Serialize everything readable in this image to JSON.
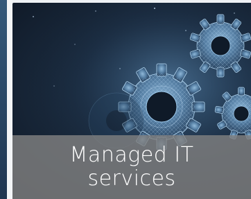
{
  "card": {
    "caption": "Managed IT services",
    "image_subject": "gears-icon"
  },
  "colors": {
    "background_dark": "#0e1724",
    "gear_highlight": "#a9d4f2",
    "caption_band": "#808080",
    "caption_text": "#ffffff",
    "left_accent": "#2b4b6a"
  }
}
